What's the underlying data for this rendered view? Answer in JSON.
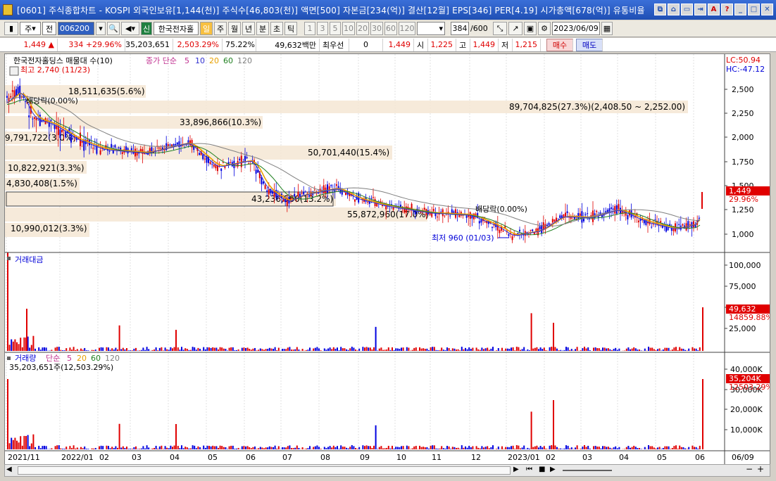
{
  "window": {
    "title": "[0601] 주식종합차트 - KOSPI 외국인보유[1,144(천)] 주식수[46,803(천)] 액면[500] 자본금[234(억)] 결산[12월] EPS[346] PER[4.19] 시가총액[678(억)] 유통비율"
  },
  "toolbar": {
    "type_select": "주",
    "prev_label": "전",
    "code": "006200",
    "name_tag": "신",
    "stock_name": "한국전자홀",
    "periods": [
      "일",
      "주",
      "월",
      "년",
      "분",
      "초",
      "틱"
    ],
    "intervals": [
      "1",
      "3",
      "5",
      "10",
      "20",
      "30",
      "60",
      "120"
    ],
    "count": "384",
    "count_total": "/600",
    "date": "2023/06/09"
  },
  "price": {
    "current": "1,449",
    "change": "334",
    "change_pct": "+29.96%",
    "volume": "35,203,651",
    "volume_ratio": "2,503.29%",
    "sub_ratio": "75.22%",
    "amount": "49,632백만",
    "pref_label": "최우선",
    "pref_value": "0",
    "quote": "1,449",
    "open_label": "시",
    "open": "1,225",
    "high_label": "고",
    "high": "1,449",
    "low_label": "저",
    "low": "1,215",
    "buy": "매수",
    "sell": "매도"
  },
  "panel1": {
    "legend_title": "한국전자홀딩스 매물대 수(10)",
    "ma_label": "종가 단순",
    "ma_periods": [
      "5",
      "10",
      "20",
      "60",
      "120"
    ],
    "lc": "LC:50.94",
    "hc": "HC:-47.12",
    "y_ticks": [
      "2,500",
      "2,250",
      "2,000",
      "1,750",
      "1,500",
      "1,250",
      "1,000"
    ],
    "last_price": "1,449",
    "last_pct": "29.96%",
    "high_note": "최고 2,740 (11/23)",
    "low_note": "최저 960 (01/03)",
    "dividend1": "배당락(0.00%)",
    "dividend2": "배당락(0.00%)"
  },
  "volume_profile": [
    {
      "label": "18,511,635(5.6%)"
    },
    {
      "label": "89,704,825(27.3%)(2,408.50 ~ 2,252.00)"
    },
    {
      "label": "33,896,866(10.3%)"
    },
    {
      "label": "9,791,722(3.0%)"
    },
    {
      "label": "50,701,440(15.4%)"
    },
    {
      "label": "10,822,921(3.3%)"
    },
    {
      "label": "4,830,408(1.5%)"
    },
    {
      "label": "43,236,560(13.2%)"
    },
    {
      "label": "55,872,960(17.0%)"
    },
    {
      "label": "10,990,012(3.3%)"
    }
  ],
  "panel2": {
    "title": "거래대금",
    "y_ticks": [
      "100,000",
      "75,000",
      "50,000",
      "25,000"
    ],
    "last_value": "49,632",
    "last_ratio": "14859.88%"
  },
  "panel3": {
    "title": "거래량",
    "ma_label": "단순",
    "ma_periods": [
      "5",
      "20",
      "60",
      "120"
    ],
    "summary": "35,203,651주(12,503.29%)",
    "y_ticks": [
      "40,000K",
      "30,000K",
      "20,000K",
      "10,000K"
    ],
    "last_value": "35,204K",
    "last_ratio": "12503.29%"
  },
  "x_labels": [
    "2021/11",
    "2022/01",
    "02",
    "03",
    "04",
    "05",
    "06",
    "07",
    "08",
    "09",
    "10",
    "11",
    "12",
    "2023/01",
    "02",
    "03",
    "04",
    "05",
    "06",
    "06/09"
  ],
  "colors": {
    "up": "#e00000",
    "down": "#0000e0",
    "ma5": "#c03090",
    "ma10": "#3030d0",
    "ma20": "#e8a000",
    "ma60": "#208020",
    "ma120": "#808080",
    "profile": "#f5e6d3"
  }
}
